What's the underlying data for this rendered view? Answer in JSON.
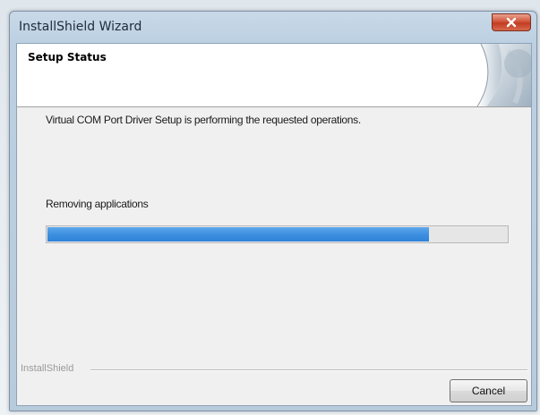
{
  "window": {
    "title": "InstallShield Wizard"
  },
  "header": {
    "title": "Setup Status"
  },
  "main": {
    "message": "Virtual COM Port Driver Setup is performing the requested operations.",
    "status": "Removing applications",
    "progress_percent": 83
  },
  "footer": {
    "brand": "InstallShield",
    "cancel_label": "Cancel"
  },
  "colors": {
    "progress_fill": "#3d8fe0",
    "close_button": "#c94b2f"
  },
  "icons": {
    "close": "close-icon",
    "header_graphic": "page-curl-graphic"
  }
}
